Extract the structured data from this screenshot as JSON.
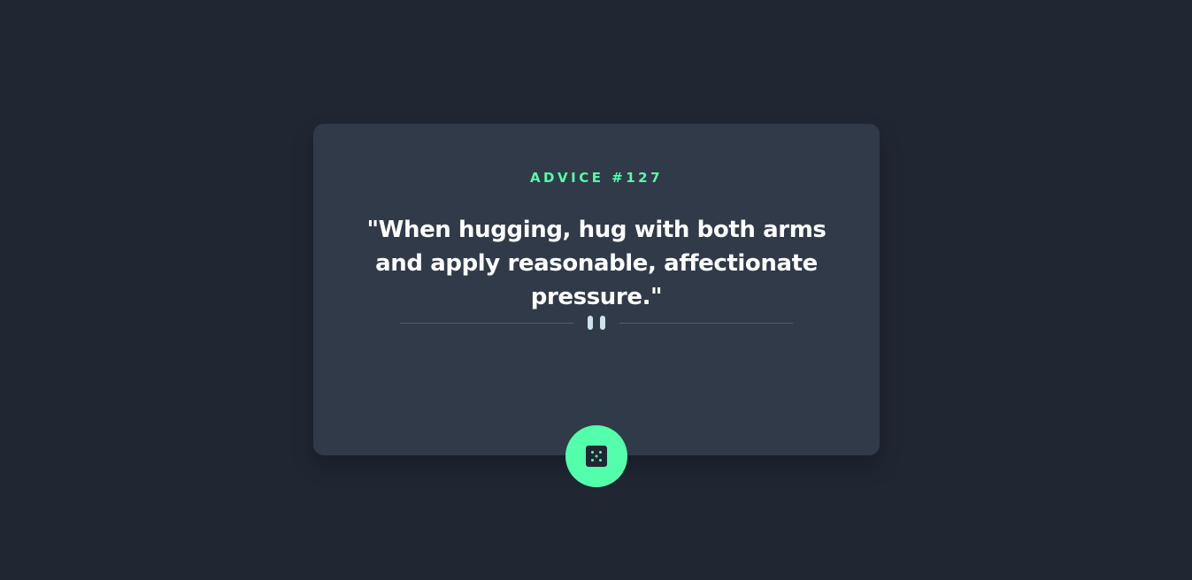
{
  "card": {
    "advice_label": "ADVICE #127",
    "advice_text": "\"When hugging, hug with both arms and apply reasonable, affectionate pressure.\""
  },
  "divider": {
    "icon": "pause-icon"
  },
  "button": {
    "icon": "dice-icon"
  },
  "colors": {
    "background": "#202733",
    "card": "#313A49",
    "accent": "#53FFAA",
    "text": "#FFFFFF",
    "divider_line": "#4F5D74",
    "divider_icon": "#CEE3E9"
  }
}
